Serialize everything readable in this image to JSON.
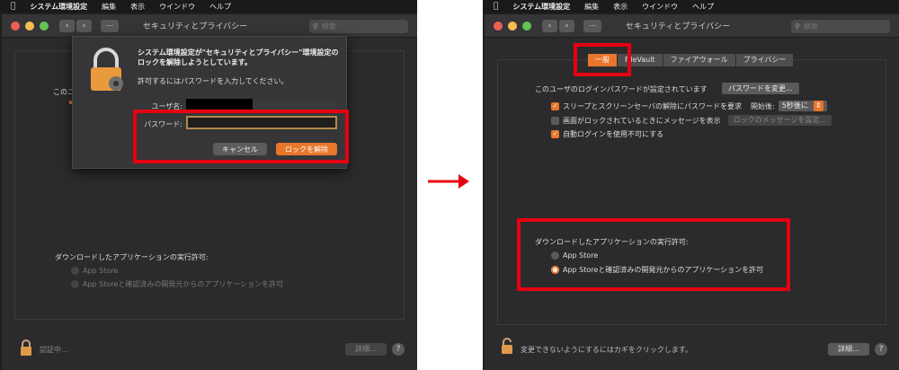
{
  "menubar": {
    "apple": "",
    "app_name": "システム環境設定",
    "items": [
      "編集",
      "表示",
      "ウインドウ",
      "ヘルプ"
    ]
  },
  "window": {
    "title": "セキュリティとプライバシー",
    "search_placeholder": "検索",
    "traffic_colors": [
      "#ec5f57",
      "#f5be4f",
      "#61c454"
    ]
  },
  "left": {
    "dialog": {
      "title": "システム環境設定が\"セキュリティとプライバシー\"環境設定のロックを解除しようとしています。",
      "subtitle": "許可するにはパスワードを入力してください。",
      "username_label": "ユーザ名:",
      "password_label": "パスワード:",
      "cancel": "キャンセル",
      "unlock": "ロックを解除"
    },
    "partial_label": "このユ",
    "download": {
      "heading": "ダウンロードしたアプリケーションの実行許可:",
      "option_appstore": "App Store",
      "option_identified": "App Storeと確認済みの開発元からのアプリケーションを許可",
      "selected": 1
    },
    "bottom": {
      "status": "認証中...",
      "detail": "詳細...",
      "help": "?"
    }
  },
  "right": {
    "tabs": [
      "一般",
      "FileVault",
      "ファイアウォール",
      "プライバシー"
    ],
    "active_tab": 0,
    "general": {
      "login_password_text": "このユーザのログインパスワードが設定されています",
      "change_password": "パスワードを変更...",
      "require_password": "スリープとスクリーンセーバの解除にパスワードを要求",
      "start_label": "開始後:",
      "start_value": "5秒後に",
      "show_message": "画面がロックされているときにメッセージを表示",
      "lock_message_btn": "ロックのメッセージを設定...",
      "disable_autologin": "自動ログインを使用不可にする",
      "checks": [
        true,
        false,
        true
      ]
    },
    "download": {
      "heading": "ダウンロードしたアプリケーションの実行許可:",
      "option_appstore": "App Store",
      "option_identified": "App Storeと確認済みの開発元からのアプリケーションを許可",
      "selected": 1
    },
    "bottom": {
      "status": "変更できないようにするにはカギをクリックします。",
      "detail": "詳細...",
      "help": "?"
    }
  },
  "colors": {
    "accent": "#e8762b",
    "highlight_box": "#e60012",
    "arrow": "#e60012"
  }
}
